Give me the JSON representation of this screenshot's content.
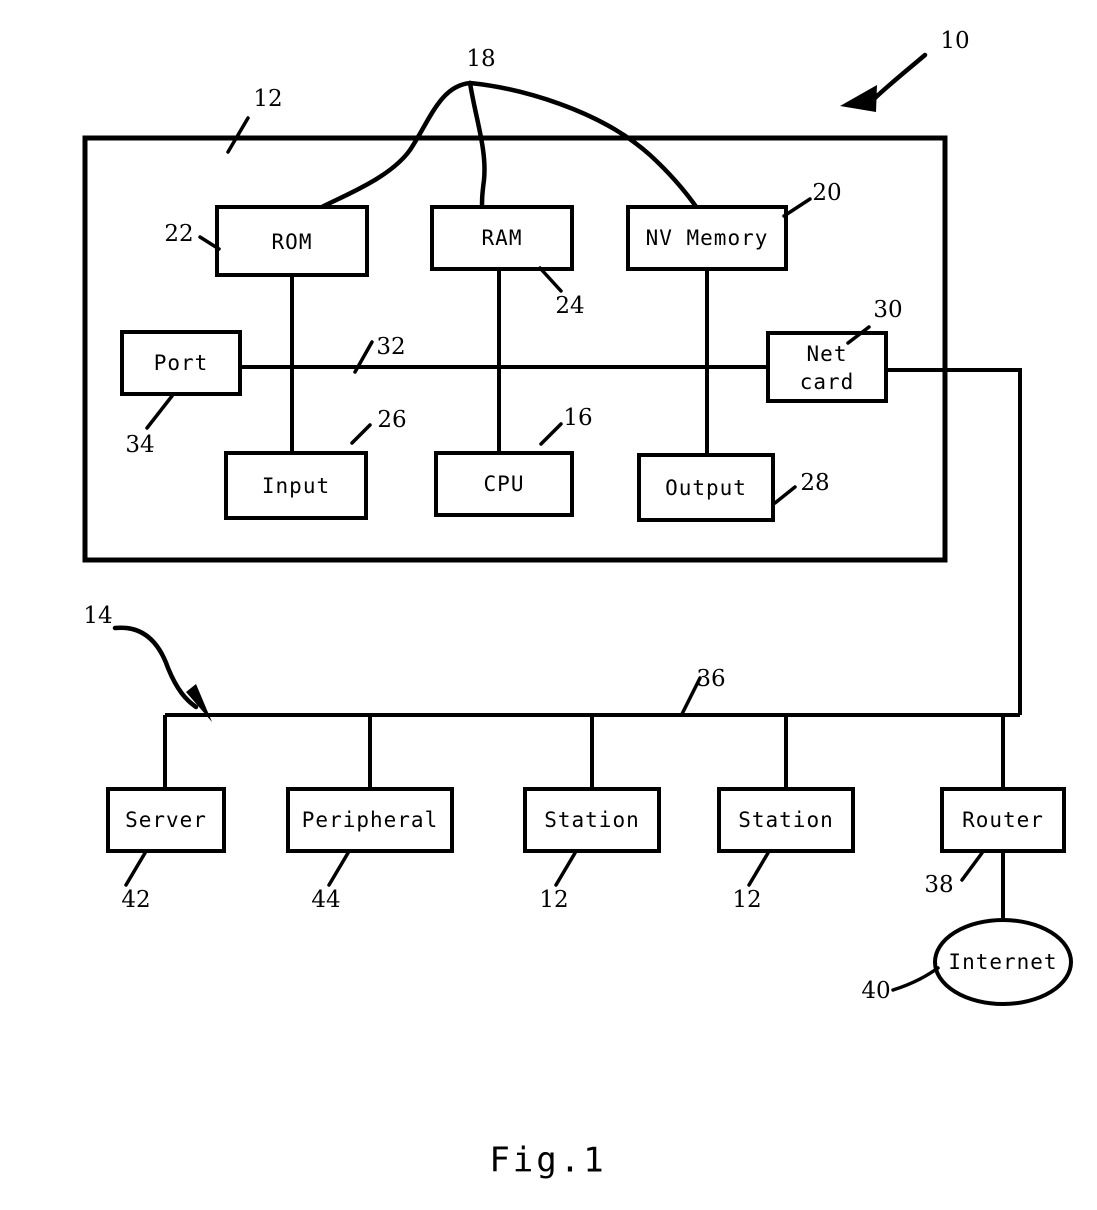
{
  "figure": {
    "caption": "Fig.1",
    "title_numeral": "10"
  },
  "computer_system": {
    "numeral": "12",
    "bus_numeral": "32",
    "interconnect_numeral": "18",
    "blocks": [
      {
        "id": "rom",
        "label": "ROM",
        "numeral": "22"
      },
      {
        "id": "ram",
        "label": "RAM",
        "numeral": "24"
      },
      {
        "id": "nv_memory",
        "label": "NV Memory",
        "numeral": "20"
      },
      {
        "id": "port",
        "label": "Port",
        "numeral": "34"
      },
      {
        "id": "net_card",
        "label_line1": "Net",
        "label_line2": "card",
        "label": "Net card",
        "numeral": "30"
      },
      {
        "id": "input",
        "label": "Input",
        "numeral": "26"
      },
      {
        "id": "cpu",
        "label": "CPU",
        "numeral": "16"
      },
      {
        "id": "output",
        "label": "Output",
        "numeral": "28"
      }
    ]
  },
  "network": {
    "numeral": "14",
    "bus_numeral": "36",
    "nodes": [
      {
        "id": "server",
        "label": "Server",
        "numeral": "42"
      },
      {
        "id": "peripheral",
        "label": "Peripheral",
        "numeral": "44"
      },
      {
        "id": "station_1",
        "label": "Station",
        "numeral": "12"
      },
      {
        "id": "station_2",
        "label": "Station",
        "numeral": "12"
      },
      {
        "id": "router",
        "label": "Router",
        "numeral": "38"
      }
    ],
    "cloud": {
      "id": "internet",
      "label": "Internet",
      "numeral": "40"
    }
  },
  "colors": {
    "ink": "#000000",
    "paper": "#ffffff"
  }
}
